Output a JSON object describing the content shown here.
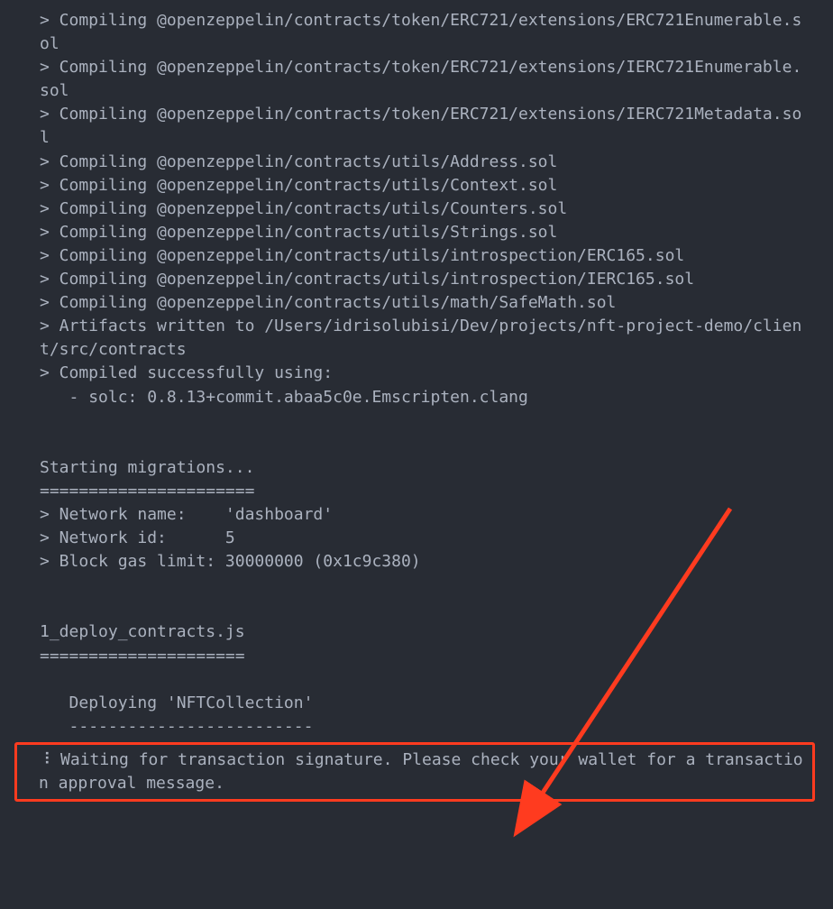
{
  "terminal": {
    "lines": [
      "> Compiling @openzeppelin/contracts/token/ERC721/extensions/ERC721Enumerable.sol",
      "> Compiling @openzeppelin/contracts/token/ERC721/extensions/IERC721Enumerable.sol",
      "> Compiling @openzeppelin/contracts/token/ERC721/extensions/IERC721Metadata.sol",
      "> Compiling @openzeppelin/contracts/utils/Address.sol",
      "> Compiling @openzeppelin/contracts/utils/Context.sol",
      "> Compiling @openzeppelin/contracts/utils/Counters.sol",
      "> Compiling @openzeppelin/contracts/utils/Strings.sol",
      "> Compiling @openzeppelin/contracts/utils/introspection/ERC165.sol",
      "> Compiling @openzeppelin/contracts/utils/introspection/IERC165.sol",
      "> Compiling @openzeppelin/contracts/utils/math/SafeMath.sol",
      "> Artifacts written to /Users/idrisolubisi/Dev/projects/nft-project-demo/client/src/contracts",
      "> Compiled successfully using:",
      "   - solc: 0.8.13+commit.abaa5c0e.Emscripten.clang",
      "",
      "",
      "Starting migrations...",
      "======================",
      "> Network name:    'dashboard'",
      "> Network id:      5",
      "> Block gas limit: 30000000 (0x1c9c380)",
      "",
      "",
      "1_deploy_contracts.js",
      "=====================",
      "",
      "   Deploying 'NFTCollection'",
      "   -------------------------"
    ],
    "waiting_message": "⠸ Waiting for transaction signature. Please check your wallet for a transaction approval message."
  },
  "annotation": {
    "arrow_color": "#ff3b1f"
  }
}
